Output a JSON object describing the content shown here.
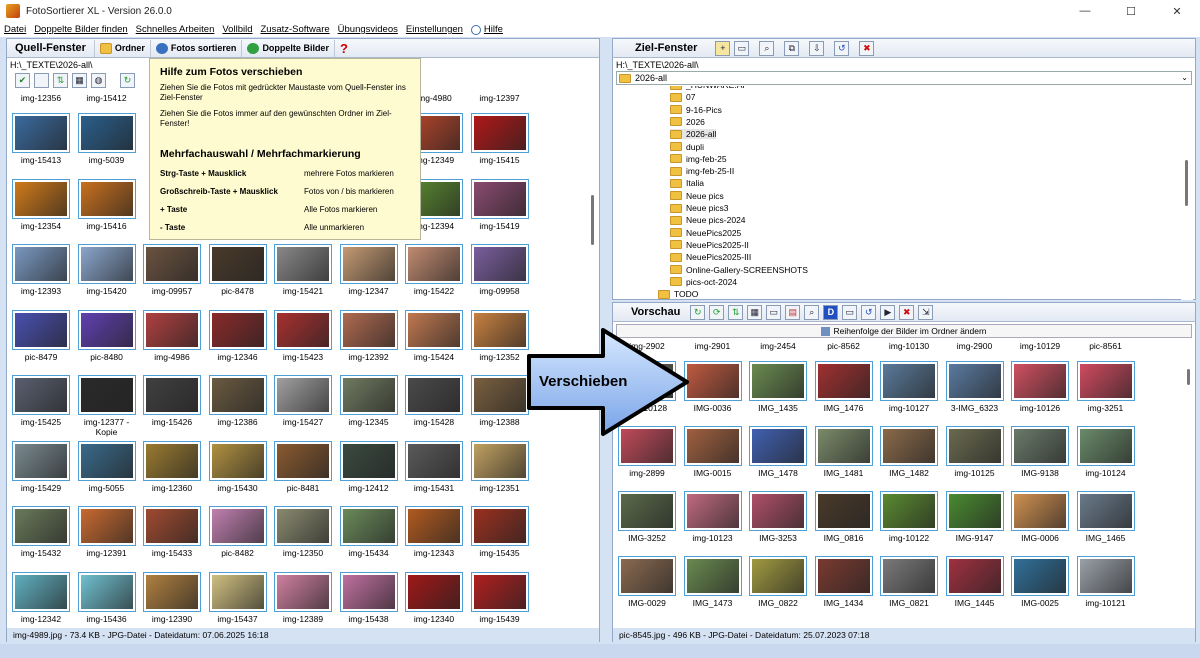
{
  "window": {
    "title": "FotoSortierer XL - Version 26.0.0",
    "min": "—",
    "max": "☐",
    "close": "✕"
  },
  "menu": [
    "Datei",
    "Doppelte Bilder finden",
    "Schnelles Arbeiten",
    "Vollbild",
    "Zusatz-Software",
    "Übungsvideos",
    "Einstellungen",
    "Hilfe"
  ],
  "source": {
    "title": "Quell-Fenster",
    "btn_folder": "Ordner",
    "btn_sort": "Fotos sortieren",
    "btn_dupes": "Doppelte Bilder",
    "btn_help": "?",
    "path": "H:\\_TEXTE\\2026-all\\",
    "top_labels": [
      "img-12356",
      "img-15412",
      "",
      "",
      "",
      "",
      "img-4980",
      "img-12397"
    ],
    "rows": [
      [
        [
          "img-15413",
          "#3a6a9e"
        ],
        [
          "img-5039",
          "#2a5f8c"
        ],
        [
          "",
          ""
        ],
        [
          "",
          ""
        ],
        [
          "",
          ""
        ],
        [
          "",
          ""
        ],
        [
          "img-12349",
          "#b8452a"
        ],
        [
          "img-15415",
          "#b01818"
        ]
      ],
      [
        [
          "img-12354",
          "#d07a1a"
        ],
        [
          "img-15416",
          "#c8701e"
        ],
        [
          "",
          ""
        ],
        [
          "",
          ""
        ],
        [
          "",
          ""
        ],
        [
          "",
          ""
        ],
        [
          "img-12394",
          "#5a8a30"
        ],
        [
          "img-15419",
          "#8a4a70"
        ]
      ],
      [
        [
          "img-12393",
          "#7a98c0"
        ],
        [
          "img-15420",
          "#8aa6cc"
        ],
        [
          "img-09957",
          "#6a5240"
        ],
        [
          "pic-8478",
          "#4a3a2a"
        ],
        [
          "img-15421",
          "#888888"
        ],
        [
          "img-12347",
          "#c49a72"
        ],
        [
          "img-15422",
          "#c08a70"
        ],
        [
          "img-09958",
          "#7a5e9e"
        ]
      ],
      [
        [
          "pic-8479",
          "#4a50b0"
        ],
        [
          "pic-8480",
          "#6040b0"
        ],
        [
          "img-4986",
          "#b04040"
        ],
        [
          "img-12346",
          "#8a2a2a"
        ],
        [
          "img-15423",
          "#a83030"
        ],
        [
          "img-12392",
          "#b06a50"
        ],
        [
          "img-15424",
          "#c07850"
        ],
        [
          "img-12352",
          "#c88040"
        ]
      ],
      [
        [
          "img-15425",
          "#5a6070"
        ],
        [
          "img-12377 - Kopie",
          "#2a2a2a"
        ],
        [
          "img-15426",
          "#404040"
        ],
        [
          "img-12386",
          "#6a5a40"
        ],
        [
          "img-15427",
          "#a0a0a0"
        ],
        [
          "img-12345",
          "#707a60"
        ],
        [
          "img-15428",
          "#4a4a4a"
        ],
        [
          "img-12388",
          "#7a6040"
        ]
      ],
      [
        [
          "img-15429",
          "#7a8a90"
        ],
        [
          "img-5055",
          "#3a6a8a"
        ],
        [
          "img-12360",
          "#9a7a30"
        ],
        [
          "img-15430",
          "#b09040"
        ],
        [
          "pic-8481",
          "#8a5a30"
        ],
        [
          "img-12412",
          "#3a4a40"
        ],
        [
          "img-15431",
          "#5a5a5a"
        ],
        [
          "img-12351",
          "#c0a060"
        ]
      ],
      [
        [
          "img-15432",
          "#6a7a5a"
        ],
        [
          "img-12391",
          "#c86a30"
        ],
        [
          "img-15433",
          "#a04a30"
        ],
        [
          "pic-8482",
          "#c080b0"
        ],
        [
          "img-12350",
          "#8a8a70"
        ],
        [
          "img-15434",
          "#6a8a5a"
        ],
        [
          "img-12343",
          "#b05a20"
        ],
        [
          "img-15435",
          "#9a3020"
        ]
      ],
      [
        [
          "img-12342",
          "#60b0c0"
        ],
        [
          "img-15436",
          "#70c0d0"
        ],
        [
          "img-12390",
          "#b08040"
        ],
        [
          "img-15437",
          "#d0c080"
        ],
        [
          "img-12389",
          "#d080a0"
        ],
        [
          "img-15438",
          "#c070a0"
        ],
        [
          "img-12340",
          "#a01818"
        ],
        [
          "img-15439",
          "#b02020"
        ]
      ]
    ],
    "status": "img-4989.jpg - 73.4 KB - JPG-Datei - Dateidatum: 07.06.2025 16:18"
  },
  "help": {
    "title": "Hilfe zum Fotos verschieben",
    "p1": "Ziehen Sie die Fotos mit gedrückter Maustaste vom Quell-Fenster ins Ziel-Fenster",
    "p2": "Ziehen Sie die Fotos immer auf den gewünschten Ordner im Ziel-Fenster!",
    "title2": "Mehrfachauswahl / Mehrfachmarkierung",
    "rows": [
      [
        "Strg-Taste + Mausklick",
        "mehrere Fotos markieren"
      ],
      [
        "Großschreib-Taste + Mausklick",
        "Fotos  von / bis  markieren"
      ],
      [
        "+ Taste",
        "Alle Fotos markieren"
      ],
      [
        "- Taste",
        "Alle unmarkieren"
      ]
    ]
  },
  "target": {
    "title": "Ziel-Fenster",
    "path": "H:\\_TEXTE\\2026-all\\",
    "combo": "2026-all",
    "tree": [
      "_HUNWARE.AI",
      "07",
      "9-16-Pics",
      "2026",
      "2026-all",
      "dupli",
      "img-feb-25",
      "img-feb-25-II",
      "Italia",
      "Neue pics",
      "Neue pics3",
      "Neue pics-2024",
      "NeuePics2025",
      "NeuePics2025-II",
      "NeuePics2025-III",
      "Online-Gallery-SCREENSHOTS",
      "pics-oct-2024",
      "TODO"
    ]
  },
  "preview": {
    "title": "Vorschau",
    "reorder": "Reihenfolge der Bilder im Ordner ändern",
    "top_labels": [
      "img-2902",
      "img-2901",
      "img-2454",
      "pic-8562",
      "img-10130",
      "img-2900",
      "img-10129",
      "pic-8561"
    ],
    "rows": [
      [
        [
          "img-10128",
          "#6a6a60"
        ],
        [
          "IMG-0036",
          "#c05a40"
        ],
        [
          "IMG_1435",
          "#6a8a50"
        ],
        [
          "IMG_1476",
          "#a03030"
        ],
        [
          "img-10127",
          "#5a7a9a"
        ],
        [
          "3-IMG_6323",
          "#5a7aa0"
        ],
        [
          "img-10126",
          "#d05060"
        ],
        [
          "img-3251",
          "#d04a60"
        ]
      ],
      [
        [
          "img-2899",
          "#c04a5a"
        ],
        [
          "IMG-0015",
          "#a06040"
        ],
        [
          "IMG_1478",
          "#4060b0"
        ],
        [
          "IMG_1481",
          "#7a8a6a"
        ],
        [
          "IMG_1482",
          "#8a6a4a"
        ],
        [
          "img-10125",
          "#6a6a50"
        ],
        [
          "IMG-9138",
          "#6a7a6a"
        ],
        [
          "img-10124",
          "#6a8a6a"
        ]
      ],
      [
        [
          "IMG-3252",
          "#5a6a4a"
        ],
        [
          "img-10123",
          "#c06a80"
        ],
        [
          "IMG-3253",
          "#b0506a"
        ],
        [
          "IMG_0816",
          "#4a3a2a"
        ],
        [
          "img-10122",
          "#5a8a30"
        ],
        [
          "IMG-9147",
          "#4a8a30"
        ],
        [
          "IMG-0006",
          "#d09050"
        ],
        [
          "IMG_1465",
          "#6a7a8a"
        ]
      ],
      [
        [
          "IMG-0029",
          "#8a6a50"
        ],
        [
          "IMG_1473",
          "#6a8a50"
        ],
        [
          "IMG_0822",
          "#a09a40"
        ],
        [
          "IMG_1434",
          "#7a3a30"
        ],
        [
          "IMG_0821",
          "#7a7a7a"
        ],
        [
          "IMG_1445",
          "#a03040"
        ],
        [
          "IMG-0025",
          "#30709a"
        ],
        [
          "img-10121",
          "#9aa0a8"
        ]
      ]
    ],
    "status": "pic-8545.jpg - 496 KB - JPG-Datei - Dateidatum: 25.07.2023 07:18"
  },
  "arrow": {
    "label": "Verschieben"
  }
}
